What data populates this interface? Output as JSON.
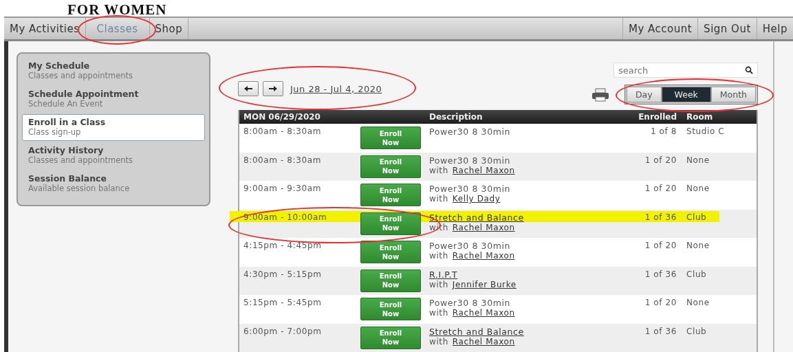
{
  "logo_text": "FOR WOMEN",
  "nav_left": [
    {
      "label": "My Activities",
      "selected": false,
      "circled": false
    },
    {
      "label": "Classes",
      "selected": true,
      "circled": true
    },
    {
      "label": "Shop",
      "selected": false,
      "circled": false
    }
  ],
  "nav_right": [
    {
      "label": "My Account"
    },
    {
      "label": "Sign Out"
    },
    {
      "label": "Help"
    }
  ],
  "sidebar": {
    "items": [
      {
        "title": "My Schedule",
        "subtitle": "Classes and appointments",
        "selected": false
      },
      {
        "title": "Schedule Appointment",
        "subtitle": "Schedule An Event",
        "selected": false
      },
      {
        "title": "Enroll in a Class",
        "subtitle": "Class sign-up",
        "selected": true
      },
      {
        "title": "Activity History",
        "subtitle": "Classes and appointments",
        "selected": false
      },
      {
        "title": "Session Balance",
        "subtitle": "Available session balance",
        "selected": false
      }
    ]
  },
  "date_nav": {
    "range": "Jun 28 - Jul 4, 2020",
    "circled": true
  },
  "search": {
    "placeholder": "search"
  },
  "view_switch": {
    "circled": true,
    "options": [
      {
        "label": "Day",
        "selected": false
      },
      {
        "label": "Week",
        "selected": true
      },
      {
        "label": "Month",
        "selected": false
      }
    ]
  },
  "table": {
    "columns": [
      "MON  06/29/2020",
      "Description",
      "Enrolled",
      "Room"
    ],
    "rows": [
      {
        "time": "8:00am - 8:30am",
        "button": "Enroll Now",
        "class": "Power30 8 30min",
        "class_link": false,
        "instructor": null,
        "enrolled": "1 of 8",
        "room": "Studio C",
        "highlighted": false,
        "circled": false
      },
      {
        "time": "8:00am - 8:30am",
        "button": "Enroll Now",
        "class": "Power30 8 30min",
        "class_link": false,
        "with": "with",
        "instructor": "Rachel Maxon",
        "enrolled": "1 of 20",
        "room": "None",
        "highlighted": false,
        "circled": false
      },
      {
        "time": "9:00am - 9:30am",
        "button": "Enroll Now",
        "class": "Power30 8 30min",
        "class_link": false,
        "with": "with",
        "instructor": "Kelly Dady",
        "enrolled": "1 of 20",
        "room": "None",
        "highlighted": false,
        "circled": false
      },
      {
        "time": "9:00am - 10:00am",
        "button": "Enroll Now",
        "class": "Stretch and Balance",
        "class_link": true,
        "with": "with",
        "instructor": "Rachel Maxon",
        "enrolled": "1 of 36",
        "room": "Club",
        "highlighted": true,
        "circled": true
      },
      {
        "time": "4:15pm - 4:45pm",
        "button": "Enroll Now",
        "class": "Power30 8 30min",
        "class_link": false,
        "with": "with",
        "instructor": "Rachel Maxon",
        "enrolled": "1 of 20",
        "room": "None",
        "highlighted": false,
        "circled": false
      },
      {
        "time": "4:30pm - 5:15pm",
        "button": "Enroll Now",
        "class": "R.I.P.T",
        "class_link": true,
        "with": "with",
        "instructor": "Jennifer Burke",
        "enrolled": "1 of 36",
        "room": "Club",
        "highlighted": false,
        "circled": false
      },
      {
        "time": "5:15pm - 5:45pm",
        "button": "Enroll Now",
        "class": "Power30 8 30min",
        "class_link": false,
        "with": "with",
        "instructor": "Rachel Maxon",
        "enrolled": "1 of 20",
        "room": "None",
        "highlighted": false,
        "circled": false
      },
      {
        "time": "6:00pm - 7:00pm",
        "button": "Enroll Now",
        "class": "Stretch and Balance",
        "class_link": true,
        "with": "with",
        "instructor": "Rachel Maxon",
        "enrolled": "1 of 36",
        "room": "Club",
        "highlighted": false,
        "circled": false
      }
    ]
  }
}
